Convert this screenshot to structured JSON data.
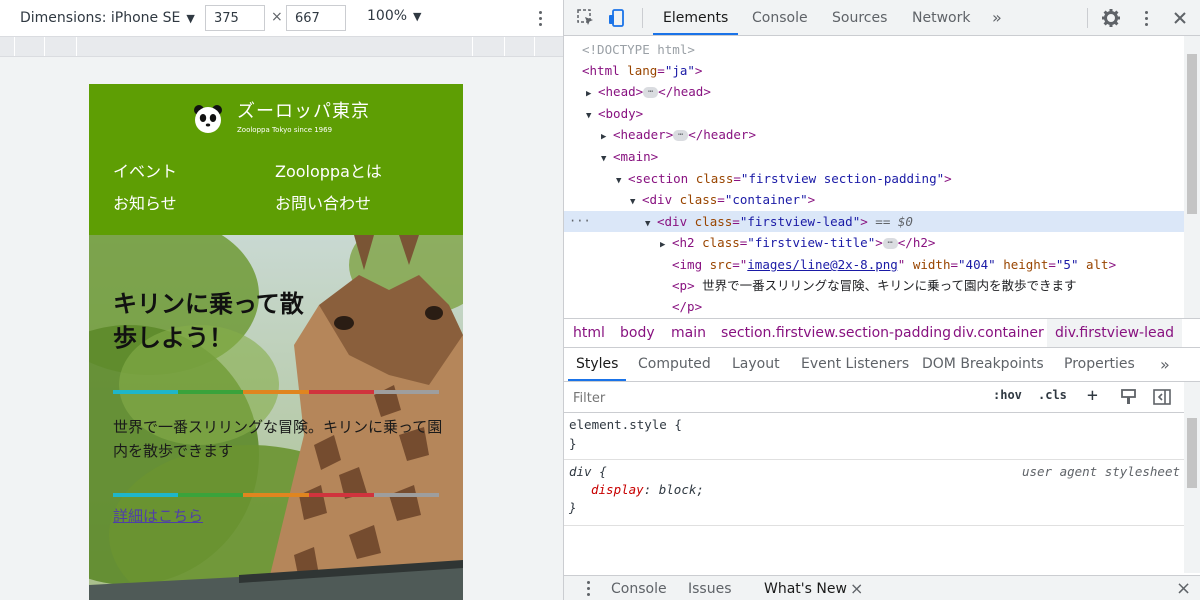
{
  "device_toolbar": {
    "dimensions_label": "Dimensions: iPhone SE",
    "width_value": "375",
    "height_value": "667",
    "times_symbol": "×",
    "zoom_label": "100%"
  },
  "site": {
    "brand_name": "ズーロッパ東京",
    "brand_sub": "Zooloppa Tokyo since 1969",
    "nav": [
      "イベント",
      "Zoolоppaとは",
      "お知らせ",
      "お問い合わせ"
    ],
    "hero_title": "キリンに乗って散歩しよう！",
    "hero_text": "世界で一番スリリングな冒険。キリンに乗って園内を散歩できます",
    "hero_link": "詳細はこちら",
    "stripe_colors": [
      "#1fb6c9",
      "#3aa33b",
      "#e0851f",
      "#d0343d",
      "#9e9e9e"
    ]
  },
  "devtools": {
    "tabs": [
      "Elements",
      "Console",
      "Sources",
      "Network"
    ],
    "more_tabs": "»",
    "dom": {
      "doctype": "<!DOCTYPE html>",
      "html_tag": "html",
      "html_attr": "lang",
      "html_val": "\"ja\"",
      "head": "head",
      "body": "body",
      "header": "header",
      "main": "main",
      "section_tag": "section",
      "section_attr": "class",
      "section_val": "\"firstview section-padding\"",
      "container_tag": "div",
      "container_attr": "class",
      "container_val": "\"container\"",
      "lead_tag": "div",
      "lead_attr": "class",
      "lead_val": "\"firstview-lead\"",
      "lead_marker": "== $0",
      "h2_tag": "h2",
      "h2_attr": "class",
      "h2_val": "\"firstview-title\"",
      "img_tag": "img",
      "img_src_attr": "src",
      "img_src_val": "images/line@2x-8.png",
      "img_w_attr": "width",
      "img_w_val": "\"404\"",
      "img_h_attr": "height",
      "img_h_val": "\"5\"",
      "img_alt_attr": "alt",
      "p_tag": "p",
      "p_text": "世界で一番スリリングな冒険、キリンに乗って園内を散歩できます",
      "p_close": "</p>"
    },
    "breadcrumbs": [
      "html",
      "body",
      "main",
      "section.firstview.section-padding",
      "div.container",
      "div.firstview-lead"
    ],
    "side_tabs": [
      "Styles",
      "Computed",
      "Layout",
      "Event Listeners",
      "DOM Breakpoints",
      "Properties"
    ],
    "filter_placeholder": "Filter",
    "hov_label": ":hov",
    "cls_label": ".cls",
    "plus_label": "+",
    "rules": {
      "element_style": "element.style {",
      "close_brace": "}",
      "div_selector": "div {",
      "ua_label": "user agent stylesheet",
      "prop_name": "display",
      "prop_value": "block;"
    },
    "drawer_tabs": [
      "Console",
      "Issues",
      "What's New"
    ],
    "close_symbol": "×"
  }
}
